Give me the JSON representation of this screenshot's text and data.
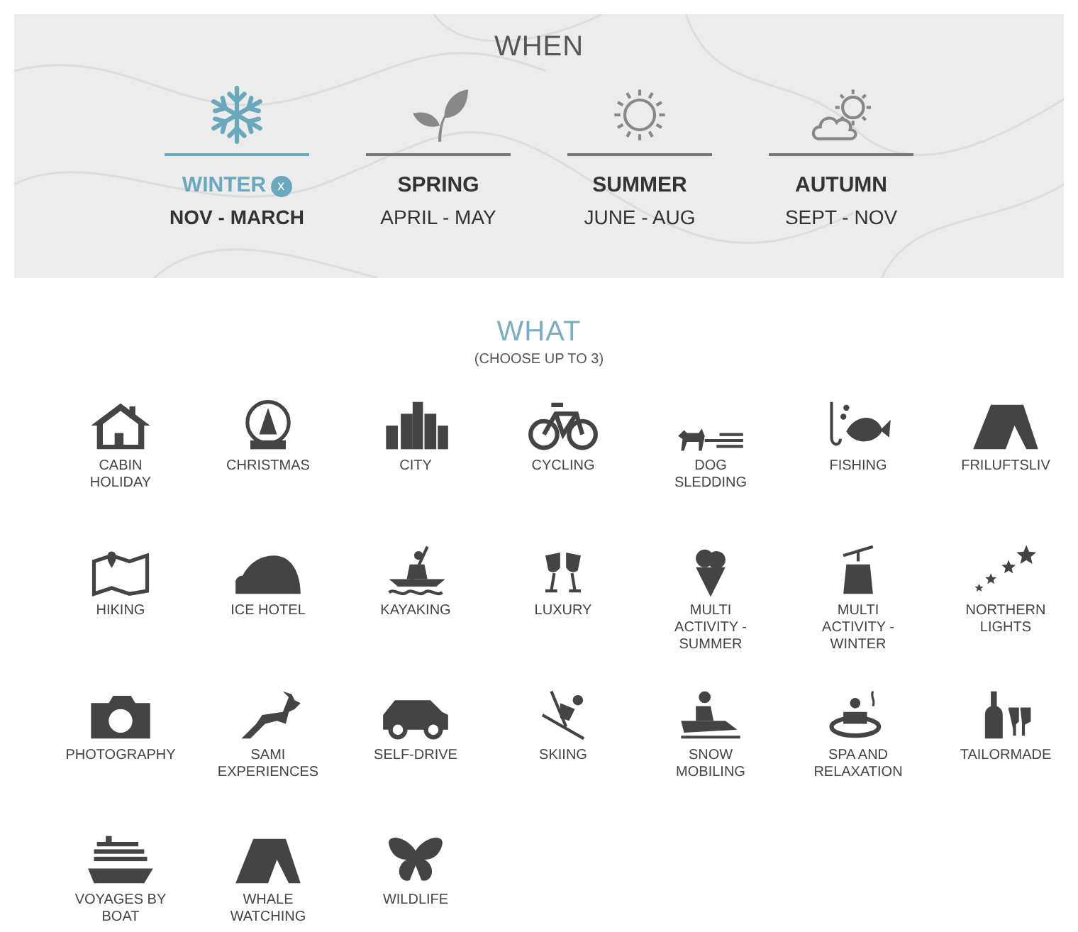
{
  "when": {
    "title": "WHEN",
    "seasons": [
      {
        "name": "WINTER",
        "months": "NOV - MARCH",
        "selected": true,
        "clear": "x"
      },
      {
        "name": "SPRING",
        "months": "APRIL - MAY",
        "selected": false
      },
      {
        "name": "SUMMER",
        "months": "JUNE - AUG",
        "selected": false
      },
      {
        "name": "AUTUMN",
        "months": "SEPT - NOV",
        "selected": false
      }
    ]
  },
  "what": {
    "title": "WHAT",
    "subtitle": "(CHOOSE UP TO 3)",
    "activities": [
      {
        "label": "CABIN\nHOLIDAY"
      },
      {
        "label": "CHRISTMAS"
      },
      {
        "label": "CITY"
      },
      {
        "label": "CYCLING"
      },
      {
        "label": "DOG\nSLEDDING"
      },
      {
        "label": "FISHING"
      },
      {
        "label": "FRILUFTSLIV"
      },
      {
        "label": "HIKING"
      },
      {
        "label": "ICE HOTEL"
      },
      {
        "label": "KAYAKING"
      },
      {
        "label": "LUXURY"
      },
      {
        "label": "MULTI\nACTIVITY -\nSUMMER"
      },
      {
        "label": "MULTI\nACTIVITY -\nWINTER"
      },
      {
        "label": "NORTHERN\nLIGHTS"
      },
      {
        "label": "PHOTOGRAPHY"
      },
      {
        "label": "SAMI\nEXPERIENCES"
      },
      {
        "label": "SELF-DRIVE"
      },
      {
        "label": "SKIING"
      },
      {
        "label": "SNOW\nMOBILING"
      },
      {
        "label": "SPA AND\nRELAXATION"
      },
      {
        "label": "TAILORMADE"
      },
      {
        "label": "VOYAGES BY\nBOAT"
      },
      {
        "label": "WHALE\nWATCHING"
      },
      {
        "label": "WILDLIFE"
      }
    ]
  }
}
